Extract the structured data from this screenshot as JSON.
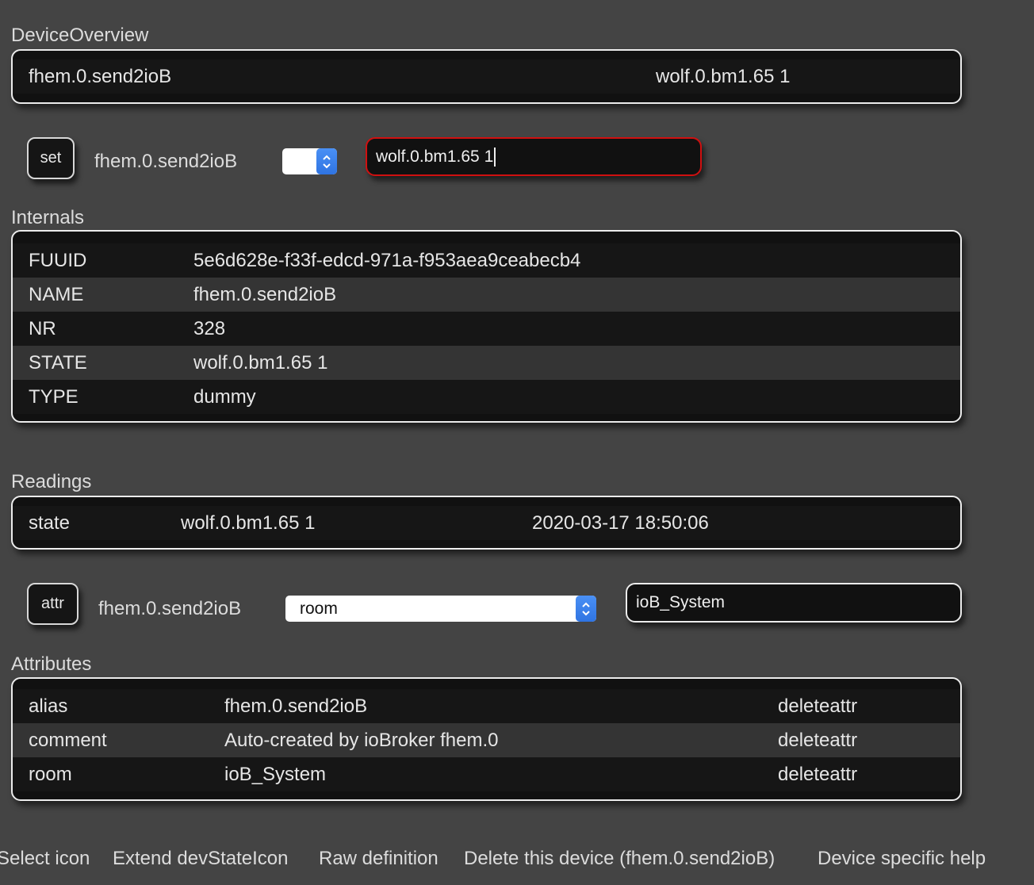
{
  "device_overview": {
    "title": "DeviceOverview",
    "name": "fhem.0.send2ioB",
    "state": "wolf.0.bm1.65 1"
  },
  "set_panel": {
    "button_label": "set",
    "device": "fhem.0.send2ioB",
    "select_value": "",
    "input_value": "wolf.0.bm1.65 1"
  },
  "internals": {
    "title": "Internals",
    "rows": [
      {
        "key": "FUUID",
        "value": "5e6d628e-f33f-edcd-971a-f953aea9ceabecb4"
      },
      {
        "key": "NAME",
        "value": "fhem.0.send2ioB"
      },
      {
        "key": "NR",
        "value": "328"
      },
      {
        "key": "STATE",
        "value": "wolf.0.bm1.65 1"
      },
      {
        "key": "TYPE",
        "value": "dummy"
      }
    ]
  },
  "readings": {
    "title": "Readings",
    "rows": [
      {
        "key": "state",
        "value": "wolf.0.bm1.65 1",
        "time": "2020-03-17 18:50:06"
      }
    ]
  },
  "attr_panel": {
    "button_label": "attr",
    "device": "fhem.0.send2ioB",
    "select_value": "room",
    "input_value": "ioB_System"
  },
  "attributes": {
    "title": "Attributes",
    "rows": [
      {
        "key": "alias",
        "value": "fhem.0.send2ioB",
        "action": "deleteattr"
      },
      {
        "key": "comment",
        "value": "Auto-created by ioBroker fhem.0",
        "action": "deleteattr"
      },
      {
        "key": "room",
        "value": "ioB_System",
        "action": "deleteattr"
      }
    ]
  },
  "footer": {
    "links": [
      "Select icon",
      "Extend devStateIcon",
      "Raw definition",
      "Delete this device (fhem.0.send2ioB)",
      "Device specific help"
    ]
  },
  "colors": {
    "background": "#444444",
    "block_background": "#111111",
    "active_input_border": "#d01010",
    "select_accent": "#3b82f0"
  }
}
